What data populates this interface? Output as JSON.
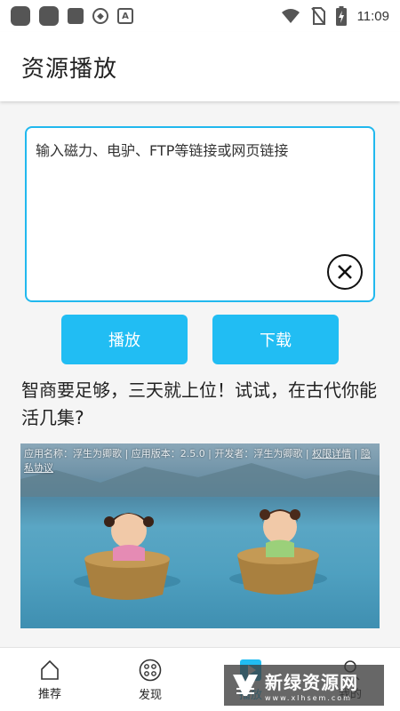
{
  "status_bar": {
    "time": "11:09",
    "icons": [
      "notification-icon",
      "notification-icon",
      "notification-icon",
      "shield-icon",
      "a-icon",
      "wifi-icon",
      "no-sim-icon",
      "battery-charging-icon"
    ]
  },
  "header": {
    "title": "资源播放"
  },
  "input": {
    "placeholder": "输入磁力、电驴、FTP等链接或网页链接"
  },
  "buttons": {
    "play": "播放",
    "download": "下载"
  },
  "ad": {
    "title": "智商要足够，三天就上位！试试，在古代你能活几集?",
    "meta_prefix": "应用名称：浮生为卿歌 | 应用版本：2.5.0 | 开发者：浮生为卿歌 | ",
    "permission_link": "权限详情",
    "meta_sep": " | ",
    "privacy_link": "隐私协议"
  },
  "nav": {
    "items": [
      {
        "label": "推荐",
        "icon": "home-icon"
      },
      {
        "label": "发现",
        "icon": "discover-icon"
      },
      {
        "label": "播放",
        "icon": "play-icon"
      },
      {
        "label": "我的",
        "icon": "profile-icon"
      }
    ],
    "active_index": 2
  },
  "watermark": {
    "text": "新绿资源网",
    "sub": "www.xlhsem.com"
  },
  "colors": {
    "accent": "#21bdf3",
    "border": "#21b8ee"
  }
}
